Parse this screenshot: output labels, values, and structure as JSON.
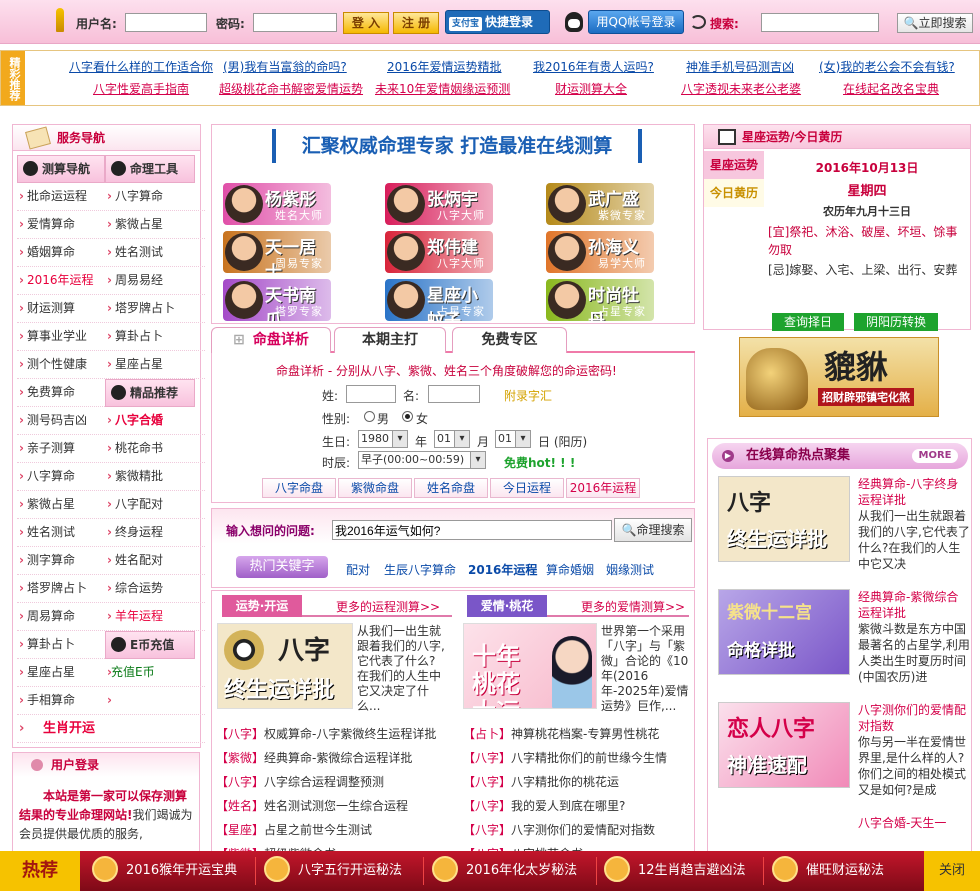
{
  "header": {
    "username_label": "用户名:",
    "password_label": "密码:",
    "login_button": "登 入",
    "register_button": "注 册",
    "alipay_logo": "支付宝",
    "alipay_button": "快捷登录",
    "qq_button": "用QQ帐号登录",
    "search_label": "搜索:",
    "search_button": "立即搜索"
  },
  "recommend": {
    "tag": "精彩推荐",
    "row1": [
      "八字看什么样的工作适合你",
      "(男)我有当富翁的命吗?",
      "2016年爱情运势精批",
      "我2016年有贵人运吗?",
      "神准手机号码测吉凶",
      "(女)我的老公会不会有钱?"
    ],
    "row2": [
      "八字性爱高手指南",
      "超级桃花命书解密爱情运势",
      "未来10年爱情姻缘运预测",
      "财运测算大全",
      "八字透视未来老公老婆",
      "在线起名改名宝典"
    ]
  },
  "left_nav": {
    "title": "服务导航",
    "header1_left": "测算导航",
    "header1_right": "命理工具",
    "rows": [
      [
        "批命运运程",
        "八字算命"
      ],
      [
        "爱情算命",
        "紫微占星"
      ],
      [
        "婚姻算命",
        "姓名测试"
      ],
      [
        "2016年运程",
        "周易易经"
      ],
      [
        "财运测算",
        "塔罗牌占卜"
      ],
      [
        "算事业学业",
        "算卦占卜"
      ],
      [
        "测个性健康",
        "星座占星"
      ]
    ],
    "header2_right": "精品推荐",
    "row_free": "免费算命",
    "rows2": [
      [
        "测号码吉凶",
        "八字合婚"
      ],
      [
        "亲子测算",
        "桃花命书"
      ],
      [
        "八字算命",
        "紫微精批"
      ],
      [
        "紫微占星",
        "八字配对"
      ],
      [
        "姓名测试",
        "终身运程"
      ],
      [
        "测字算命",
        "姓名配对"
      ],
      [
        "塔罗牌占卜",
        "综合运势"
      ],
      [
        "周易算命",
        "羊年运程"
      ]
    ],
    "header3_right": "E币充值",
    "rows3": [
      [
        "算卦占卜",
        "充值E币"
      ],
      [
        "星座占星",
        ""
      ],
      [
        "手相算命",
        ""
      ]
    ],
    "last": "生肖开运"
  },
  "login_box": {
    "title": "用户登录",
    "text_red": "本站是第一家可以保存测算结果的专业命理网站!",
    "text": "我们竭诚为会员提供最优质的服务,"
  },
  "banner": {
    "slogan": "汇聚权威命理专家 打造最准在线测算",
    "masters": [
      {
        "name": "杨紫彤",
        "title": "姓名大师",
        "color": "#e04fa8"
      },
      {
        "name": "张炳宇",
        "title": "八字大师",
        "color": "#d81e5b"
      },
      {
        "name": "武广盛",
        "title": "紫微专家",
        "color": "#b58a1a"
      },
      {
        "name": "天一居士",
        "title": "周易专家",
        "color": "#c8731e"
      },
      {
        "name": "郑伟建",
        "title": "八字大师",
        "color": "#d8243a"
      },
      {
        "name": "孙海义",
        "title": "易学大师",
        "color": "#e0752a"
      },
      {
        "name": "天书南瓜",
        "title": "塔罗专家",
        "color": "#a44ac8"
      },
      {
        "name": "星座小蚊子",
        "title": "占星专家",
        "color": "#2a74c8"
      },
      {
        "name": "时尚牡丹",
        "title": "占星专家",
        "color": "#8ab81e"
      }
    ]
  },
  "tabs": [
    "命盘详析",
    "本期主打",
    "免费专区"
  ],
  "form": {
    "intro": "命盘详析 - 分别从八字、紫微、姓名三个角度破解您的命运密码!",
    "surname": "姓:",
    "name": "名:",
    "rare_chars": "附录字汇",
    "gender": "性别:",
    "male": "男",
    "female": "女",
    "birth": "生日:",
    "year": "1980",
    "year_unit": "年",
    "month": "01",
    "month_unit": "月",
    "day": "01",
    "day_unit": "日 (阳历)",
    "hour_label": "时辰:",
    "hour": "早子(00:00~00:59)",
    "free_hot": "免费hot! ! !",
    "buttons": [
      "八字命盘",
      "紫微命盘",
      "姓名命盘",
      "今日运程",
      "2016年运程"
    ]
  },
  "ask": {
    "label": "输入想问的问题:",
    "value": "我2016年运气如何?",
    "button": "命理搜索",
    "hot_label": "热门关键字",
    "keywords": [
      "配对",
      "生辰八字算命",
      "2016年运程",
      "算命婚姻",
      "姻缘测试"
    ]
  },
  "fortune_section": {
    "tag": "运势·开运",
    "more": "更多的运程测算>>",
    "thumb_top": "八字",
    "thumb_bottom": "终生运详批",
    "desc": "从我们一出生就跟着我们的八字,它代表了什么?在我们的人生中它又决定了什么...",
    "items": [
      {
        "tag": "【八字】",
        "text": "权威算命-八字紫微终生运程详批"
      },
      {
        "tag": "【紫微】",
        "text": "经典算命-紫微综合运程详批"
      },
      {
        "tag": "【八字】",
        "text": "八字综合运程调整预测"
      },
      {
        "tag": "【姓名】",
        "text": "姓名测试测您一生综合运程"
      },
      {
        "tag": "【星座】",
        "text": "占星之前世今生测试"
      },
      {
        "tag": "【紫微】",
        "text": "超级紫微命书"
      }
    ]
  },
  "love_section": {
    "tag": "爱情·桃花",
    "more": "更多的爱情测算>>",
    "thumb_text": "十年桃花大运",
    "desc": "世界第一个采用「八字」与「紫微」合论的《10年(2016年-2025年)爱情运势》巨作,...",
    "items": [
      {
        "tag": "【占卜】",
        "text": "神算桃花档案-专算男性桃花"
      },
      {
        "tag": "【八字】",
        "text": "八字精批你们的前世缘今生情"
      },
      {
        "tag": "【八字】",
        "text": "八字精批你的桃花运"
      },
      {
        "tag": "【八字】",
        "text": "我的爱人到底在哪里?"
      },
      {
        "tag": "【八字】",
        "text": "八字测你们的爱情配对指数"
      },
      {
        "tag": "【八字】",
        "text": "八字桃花命书"
      }
    ]
  },
  "right_top": {
    "title": "星座运势/今日黄历",
    "tab1": "星座运势",
    "tab2": "今日黄历",
    "date": "2016年10月13日",
    "weekday": "星期四",
    "lunar": "农历年九月十三日",
    "yi_label": "[宜]",
    "yi": "祭祀、沐浴、破屋、坏垣、馀事勿取",
    "ji_label": "[忌]",
    "ji": "嫁娶、入宅、上梁、出行、安葬",
    "btn1": "查询择日",
    "btn2": "阴阳历转换"
  },
  "ad": {
    "text": "貔貅",
    "sub": "招财辟邪镇宅化煞"
  },
  "hot_section": {
    "title": "在线算命热点聚集",
    "more": "MORE",
    "items": [
      {
        "title": "经典算命-八字终身运程详批",
        "desc": "从我们一出生就跟着我们的八字,它代表了什么?在我们的人生中它又决",
        "pic_top": "八字",
        "pic_bottom": "终生运详批"
      },
      {
        "title": "经典算命-紫微综合运程详批",
        "desc": "紫微斗数是东方中国最著名的占星学,利用人类出生时夏历时间(中国农历)进",
        "pic_top": "紫微十二宫",
        "pic_bottom": "命格详批"
      },
      {
        "title": "八字测你们的爱情配对指数",
        "desc": "你与另一半在爱情世界里,是什么样的人?你们之间的相处模式又是如何?是成",
        "pic_top": "恋人八字",
        "pic_bottom": "神准速配"
      },
      {
        "title": "八字合婚-天生一",
        "desc": "",
        "pic_top": "",
        "pic_bottom": ""
      }
    ]
  },
  "bottom_bar": {
    "hot": "热荐",
    "items": [
      "2016猴年开运宝典",
      "八字五行开运秘法",
      "2016年化太岁秘法",
      "12生肖趋吉避凶法",
      "催旺财运秘法"
    ],
    "close": "关闭"
  }
}
